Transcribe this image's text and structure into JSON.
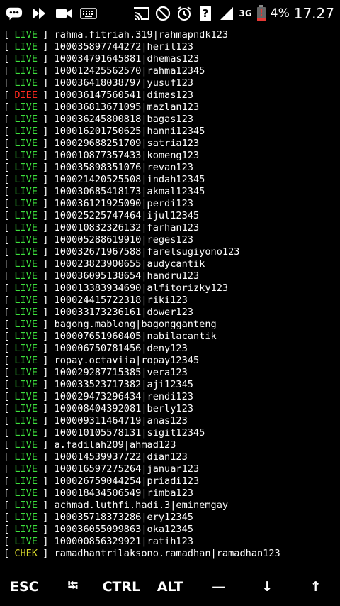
{
  "statusbar": {
    "left_icons": [
      "chat-bubble-icon",
      "play-icon",
      "video-camera-icon",
      "keyboard-icon"
    ],
    "right_icons": [
      "cast-icon",
      "do-not-disturb-icon",
      "alarm-icon",
      "question-icon",
      "signal-icon",
      "data-3g-icon",
      "battery-low-icon"
    ],
    "network_label": "3G",
    "battery": "4%",
    "time": "17.27"
  },
  "colors": {
    "live": "#3dde3d",
    "dead": "#ff2a1f",
    "check": "#d7d72a"
  },
  "terminal": {
    "lines": [
      {
        "status": "LIVE",
        "text": "rahma.fitriah.319|rahmapndk123"
      },
      {
        "status": "LIVE",
        "text": "100035897744272|heril123"
      },
      {
        "status": "LIVE",
        "text": "100034791645881|dhemas123"
      },
      {
        "status": "LIVE",
        "text": "100012425562570|rahma12345"
      },
      {
        "status": "LIVE",
        "text": "100036418038797|yusuf123"
      },
      {
        "status": "DIEE",
        "text": "100036147560541|dimas123"
      },
      {
        "status": "LIVE",
        "text": "100036813671095|mazlan123"
      },
      {
        "status": "LIVE",
        "text": "100036245800818|bagas123"
      },
      {
        "status": "LIVE",
        "text": "100016201750625|hanni12345"
      },
      {
        "status": "LIVE",
        "text": "100029688251709|satria123"
      },
      {
        "status": "LIVE",
        "text": "100010877357433|komeng123"
      },
      {
        "status": "LIVE",
        "text": "100035898351076|revan123"
      },
      {
        "status": "LIVE",
        "text": "100021420525508|indah12345"
      },
      {
        "status": "LIVE",
        "text": "100030685418173|akmal12345"
      },
      {
        "status": "LIVE",
        "text": "100036121925090|perdi123"
      },
      {
        "status": "LIVE",
        "text": "100025225747464|ijul12345"
      },
      {
        "status": "LIVE",
        "text": "100010832326132|farhan123"
      },
      {
        "status": "LIVE",
        "text": "100005288619910|reges123"
      },
      {
        "status": "LIVE",
        "text": "100032671967588|farelsugiyono123"
      },
      {
        "status": "LIVE",
        "text": "100023823900655|audycantik"
      },
      {
        "status": "LIVE",
        "text": "100036095138654|handru123"
      },
      {
        "status": "LIVE",
        "text": "100013383934690|alfitorizky123"
      },
      {
        "status": "LIVE",
        "text": "100024415722318|riki123"
      },
      {
        "status": "LIVE",
        "text": "100033173236161|dower123"
      },
      {
        "status": "LIVE",
        "text": "bagong.mablong|bagongganteng"
      },
      {
        "status": "LIVE",
        "text": "100007651960405|nabilacantik"
      },
      {
        "status": "LIVE",
        "text": "100006750781456|deny123"
      },
      {
        "status": "LIVE",
        "text": "ropay.octaviia|ropay12345"
      },
      {
        "status": "LIVE",
        "text": "100029287715385|vera123"
      },
      {
        "status": "LIVE",
        "text": "100033523717382|aji12345"
      },
      {
        "status": "LIVE",
        "text": "100029473296434|rendi123"
      },
      {
        "status": "LIVE",
        "text": "100008404392081|berly123"
      },
      {
        "status": "LIVE",
        "text": "100009311464719|anas123"
      },
      {
        "status": "LIVE",
        "text": "100010105578131|sigit12345"
      },
      {
        "status": "LIVE",
        "text": "a.fadilah209|ahmad123"
      },
      {
        "status": "LIVE",
        "text": "100014539937722|dian123"
      },
      {
        "status": "LIVE",
        "text": "100016597275264|januar123"
      },
      {
        "status": "LIVE",
        "text": "100026759044254|priadi123"
      },
      {
        "status": "LIVE",
        "text": "100018434506549|rimba123"
      },
      {
        "status": "LIVE",
        "text": "achmad.luthfi.hadi.3|eminemgay"
      },
      {
        "status": "LIVE",
        "text": "100035718373286|ery12345"
      },
      {
        "status": "LIVE",
        "text": "100036055099863|oka12345"
      },
      {
        "status": "LIVE",
        "text": "100000856329921|ratih123"
      },
      {
        "status": "CHEK",
        "text": "ramadhantrilaksono.ramadhan|ramadhan123"
      }
    ]
  },
  "extra_keys": [
    {
      "label": "ESC",
      "name": "esc-key"
    },
    {
      "label": "⭾",
      "name": "tab-key"
    },
    {
      "label": "CTRL",
      "name": "ctrl-key"
    },
    {
      "label": "ALT",
      "name": "alt-key"
    },
    {
      "label": "—",
      "name": "dash-key"
    },
    {
      "label": "↓",
      "name": "arrow-down-key"
    },
    {
      "label": "↑",
      "name": "arrow-up-key"
    }
  ]
}
